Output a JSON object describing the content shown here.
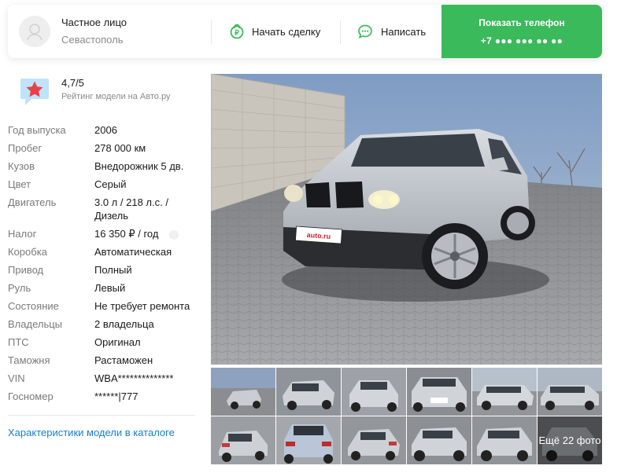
{
  "seller": {
    "name": "Частное лицо",
    "city": "Севастополь"
  },
  "actions": {
    "deal": "Начать сделку",
    "message": "Написать",
    "phone_title": "Показать телефон",
    "phone_number": "+7 ●●● ●●● ●● ●●"
  },
  "rating": {
    "score": "4,7/5",
    "label": "Рейтинг модели на Авто.ру"
  },
  "specs": [
    {
      "label": "Год выпуска",
      "value": "2006"
    },
    {
      "label": "Пробег",
      "value": "278 000 км"
    },
    {
      "label": "Кузов",
      "value": "Внедорожник 5 дв."
    },
    {
      "label": "Цвет",
      "value": "Серый"
    },
    {
      "label": "Двигатель",
      "value": "3.0 л / 218 л.с. / Дизель"
    },
    {
      "label": "Налог",
      "value": "16 350 ₽ / год"
    },
    {
      "label": "Коробка",
      "value": "Автоматическая"
    },
    {
      "label": "Привод",
      "value": "Полный"
    },
    {
      "label": "Руль",
      "value": "Левый"
    },
    {
      "label": "Состояние",
      "value": "Не требует ремонта"
    },
    {
      "label": "Владельцы",
      "value": "2 владельца"
    },
    {
      "label": "ПТС",
      "value": "Оригинал"
    },
    {
      "label": "Таможня",
      "value": "Растаможен"
    },
    {
      "label": "VIN",
      "value": "WBA**************"
    },
    {
      "label": "Госномер",
      "value": "******|777"
    }
  ],
  "catalog_link": "Характеристики модели в каталоге",
  "photos": {
    "plate_text": "auto.ru",
    "more_label": "Ещё 22 фото"
  },
  "colors": {
    "accent_green": "#3aba5b",
    "link_blue": "#157ed3",
    "rating_star": "#e8404b",
    "rating_bg": "#bfe3f8"
  }
}
